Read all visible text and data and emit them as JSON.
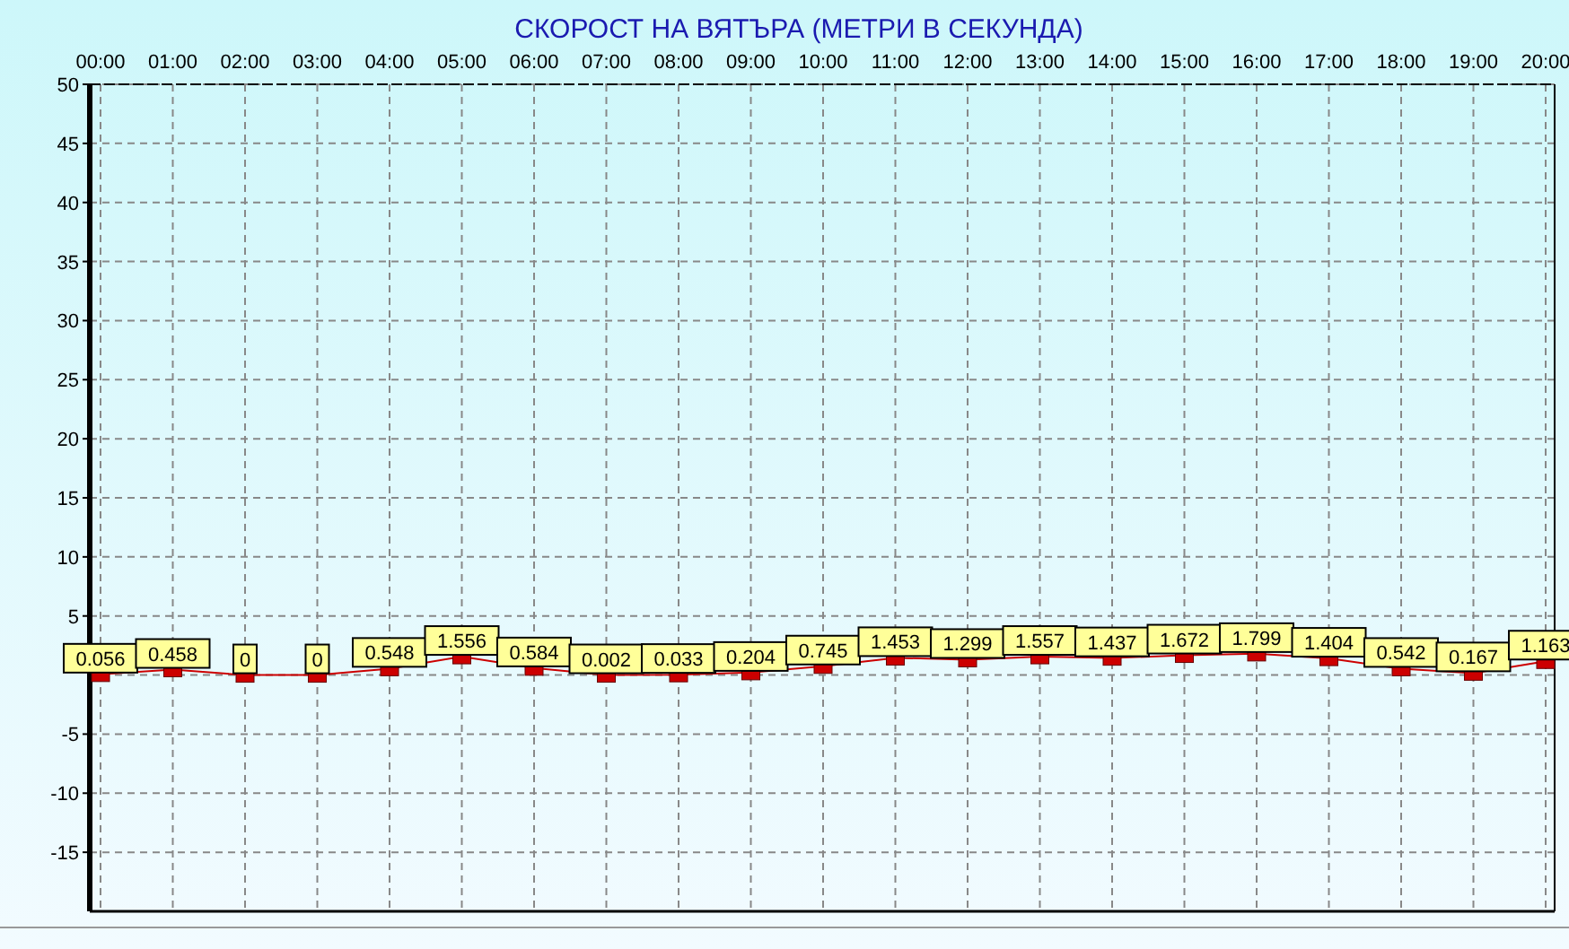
{
  "chart": {
    "chart_data": {
      "type": "line",
      "title": "СКОРОСТ НА ВЯТЪРА (МЕТРИ В СЕКУНДА)",
      "categories": [
        "00:00",
        "01:00",
        "02:00",
        "03:00",
        "04:00",
        "05:00",
        "06:00",
        "07:00",
        "08:00",
        "09:00",
        "10:00",
        "11:00",
        "12:00",
        "13:00",
        "14:00",
        "15:00",
        "16:00",
        "17:00",
        "18:00",
        "19:00",
        "20:00"
      ],
      "grid": true,
      "series": [
        {
          "color": "#cc0000",
          "marker": "square",
          "values": [
            0.056,
            0.458,
            0,
            0,
            0.548,
            1.556,
            0.584,
            0.002,
            0.033,
            0.204,
            0.745,
            1.453,
            1.299,
            1.557,
            1.437,
            1.672,
            1.799,
            1.404,
            0.542,
            0.167,
            1.163
          ]
        }
      ],
      "ylim": [
        -20,
        50
      ],
      "yticks": [
        -15,
        -10,
        -5,
        5,
        10,
        15,
        20,
        25,
        30,
        35,
        40,
        45,
        50
      ],
      "data_labels": true
    }
  }
}
